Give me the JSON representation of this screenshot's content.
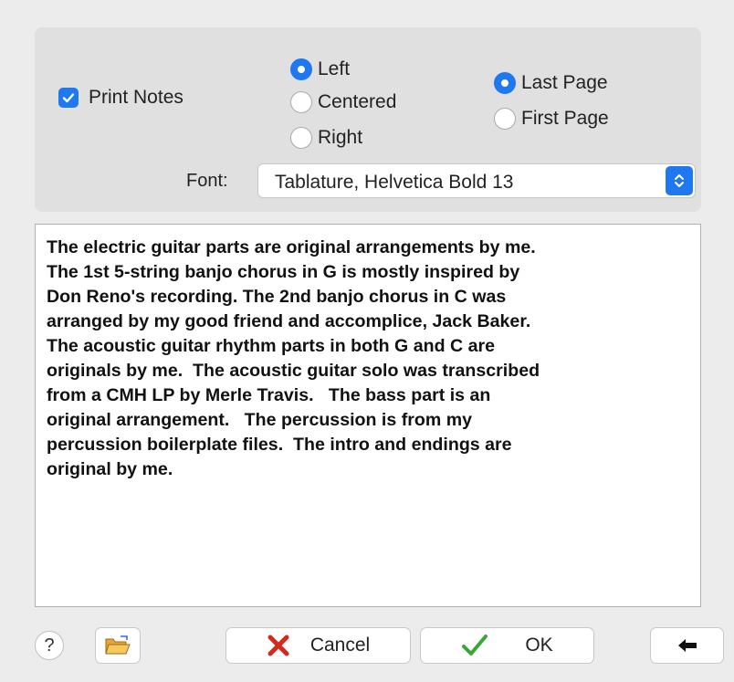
{
  "print_notes": {
    "label": "Print Notes",
    "checked": true
  },
  "alignment": {
    "options": [
      {
        "label": "Left",
        "selected": true
      },
      {
        "label": "Centered",
        "selected": false
      },
      {
        "label": "Right",
        "selected": false
      }
    ]
  },
  "page": {
    "options": [
      {
        "label": "Last Page",
        "selected": true
      },
      {
        "label": "First Page",
        "selected": false
      }
    ]
  },
  "font": {
    "label": "Font:",
    "value": "Tablature, Helvetica Bold 13"
  },
  "notes": {
    "text": "The electric guitar parts are original arrangements by me.\nThe 1st 5-string banjo chorus in G is mostly inspired by\nDon Reno's recording. The 2nd banjo chorus in C was\narranged by my good friend and accomplice, Jack Baker.\nThe acoustic guitar rhythm parts in both G and C are\noriginals by me.  The acoustic guitar solo was transcribed\nfrom a CMH LP by Merle Travis.   The bass part is an\noriginal arrangement.   The percussion is from my\npercussion boilerplate files.  The intro and endings are\noriginal by me."
  },
  "buttons": {
    "help": "?",
    "cancel": "Cancel",
    "ok": "OK"
  },
  "colors": {
    "accent": "#1f78f0",
    "cancel_x": "#d22a1e",
    "ok_check": "#3aa636",
    "folder": "#f2b94a"
  },
  "icons": [
    "help-icon",
    "open-folder-icon",
    "cancel-x-icon",
    "ok-checkmark-icon",
    "back-arrow-icon",
    "chevron-updown-icon"
  ]
}
